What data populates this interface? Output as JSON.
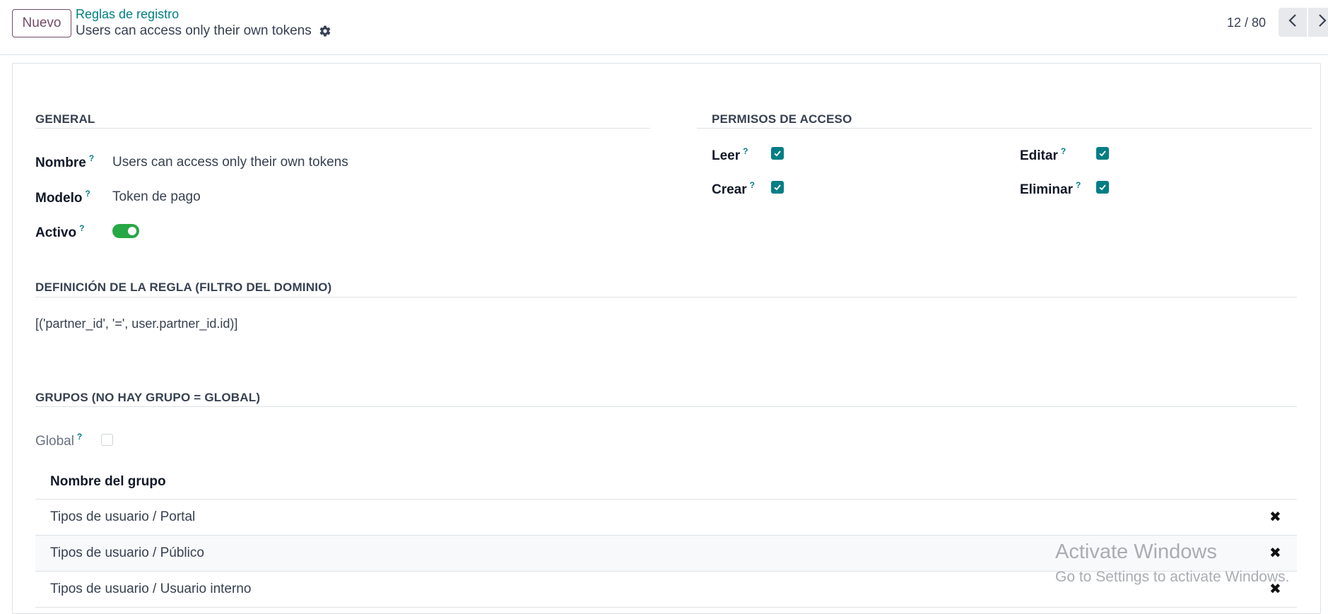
{
  "control_panel": {
    "new_button": "Nuevo",
    "breadcrumb_parent": "Reglas de registro",
    "breadcrumb_current": "Users can access only their own tokens",
    "pager_value": "12 / 80"
  },
  "general": {
    "section_title": "GENERAL",
    "fields": {
      "name_label": "Nombre",
      "name_value": "Users can access only their own tokens",
      "model_label": "Modelo",
      "model_value": "Token de pago",
      "active_label": "Activo",
      "active_value": true
    }
  },
  "access": {
    "section_title": "PERMISOS DE ACCESO",
    "read_label": "Leer",
    "create_label": "Crear",
    "write_label": "Editar",
    "unlink_label": "Eliminar",
    "read": true,
    "create": true,
    "write": true,
    "unlink": true
  },
  "rule": {
    "section_title": "DEFINICIÓN DE LA REGLA (FILTRO DEL DOMINIO)",
    "domain": "[('partner_id', '=', user.partner_id.id)]"
  },
  "groups": {
    "section_title": "GRUPOS (NO HAY GRUPO = GLOBAL)",
    "global_label": "Global",
    "global_value": false,
    "column_header": "Nombre del grupo",
    "rows": [
      "Tipos de usuario / Portal",
      "Tipos de usuario / Público",
      "Tipos de usuario / Usuario interno"
    ]
  },
  "tooltip_marker": "?",
  "watermark": {
    "line1": "Activate Windows",
    "line2": "Go to Settings to activate Windows."
  },
  "colors": {
    "brand": "#714b67",
    "accent": "#017e84",
    "toggle_on": "#28a745"
  }
}
